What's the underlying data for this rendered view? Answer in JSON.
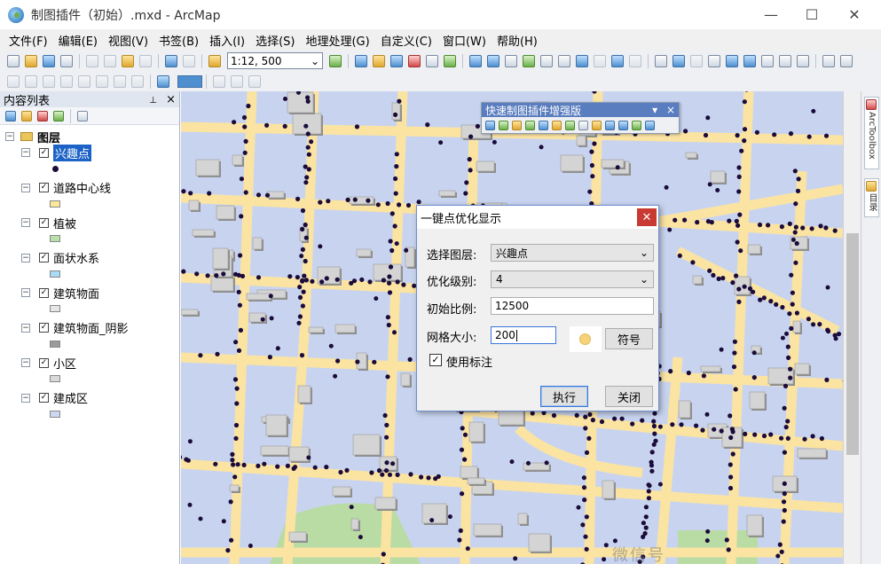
{
  "window": {
    "title": "制图插件（初始）.mxd - ArcMap",
    "controls": {
      "minimize": "—",
      "maximize": "☐",
      "close": "✕"
    }
  },
  "menubar": [
    "文件(F)",
    "编辑(E)",
    "视图(V)",
    "书签(B)",
    "插入(I)",
    "选择(S)",
    "地理处理(G)",
    "自定义(C)",
    "窗口(W)",
    "帮助(H)"
  ],
  "toolbar": {
    "scale": "1:12, 500"
  },
  "toc": {
    "title": "内容列表",
    "pin": "⊥",
    "close": "×",
    "root": "图层",
    "layers": [
      {
        "name": "兴趣点",
        "checked": true,
        "selected": true,
        "symbol": "dot",
        "color": "#1a0b3a"
      },
      {
        "name": "道路中心线",
        "checked": true,
        "selected": false,
        "symbol": "rect",
        "color": "#fbe79a"
      },
      {
        "name": "植被",
        "checked": true,
        "selected": false,
        "symbol": "rect",
        "color": "#b8e0a8"
      },
      {
        "name": "面状水系",
        "checked": true,
        "selected": false,
        "symbol": "rect",
        "color": "#a8dcf4"
      },
      {
        "name": "建筑物面",
        "checked": true,
        "selected": false,
        "symbol": "rect",
        "color": "#e6e6e6"
      },
      {
        "name": "建筑物面_阴影",
        "checked": true,
        "selected": false,
        "symbol": "rect",
        "color": "#9b9b9b"
      },
      {
        "name": "小区",
        "checked": true,
        "selected": false,
        "symbol": "rect",
        "color": "#d9d9d9"
      },
      {
        "name": "建成区",
        "checked": true,
        "selected": false,
        "symbol": "rect",
        "color": "#cdd8f2"
      }
    ]
  },
  "side_tabs": [
    "ArcToolbox",
    "目录"
  ],
  "float_toolbar": {
    "title": "快速制图插件增强版",
    "menu": "▾",
    "close": "×"
  },
  "dialog": {
    "title": "一键点优化显示",
    "close": "✕",
    "fields": {
      "layer_label": "选择图层:",
      "layer_value": "兴趣点",
      "level_label": "优化级别:",
      "level_value": "4",
      "scale_label": "初始比例:",
      "scale_value": "12500",
      "grid_label": "网格大小:",
      "grid_value": "200"
    },
    "symbol_button": "符号",
    "use_label": "使用标注",
    "use_label_checked": true,
    "run_button": "执行",
    "close_button": "关闭"
  },
  "watermark": "微信号",
  "colors": {
    "water": "#c8d4ef",
    "road": "#fbe3a2",
    "building": "#d4d4d4",
    "shadow": "#8e8e8e",
    "vegetation": "#b9dba4",
    "poi": "#1a0b3a"
  }
}
